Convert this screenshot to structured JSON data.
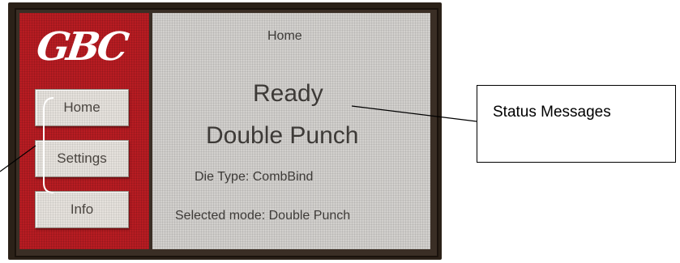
{
  "device": {
    "brand_logo": "GBC"
  },
  "sidebar": {
    "items": [
      {
        "label": "Home"
      },
      {
        "label": "Settings"
      },
      {
        "label": "Info"
      }
    ]
  },
  "main": {
    "page_title": "Home",
    "status": "Ready",
    "mode": "Double Punch",
    "die_type": "Die Type: CombBind",
    "selected_mode": "Selected  mode: Double Punch"
  },
  "annotation": {
    "callout_label": "Status Messages"
  },
  "colors": {
    "sidebar_red": "#b81c22",
    "content_grey": "#d2d0cd",
    "button_grey": "#e5e1dc"
  }
}
